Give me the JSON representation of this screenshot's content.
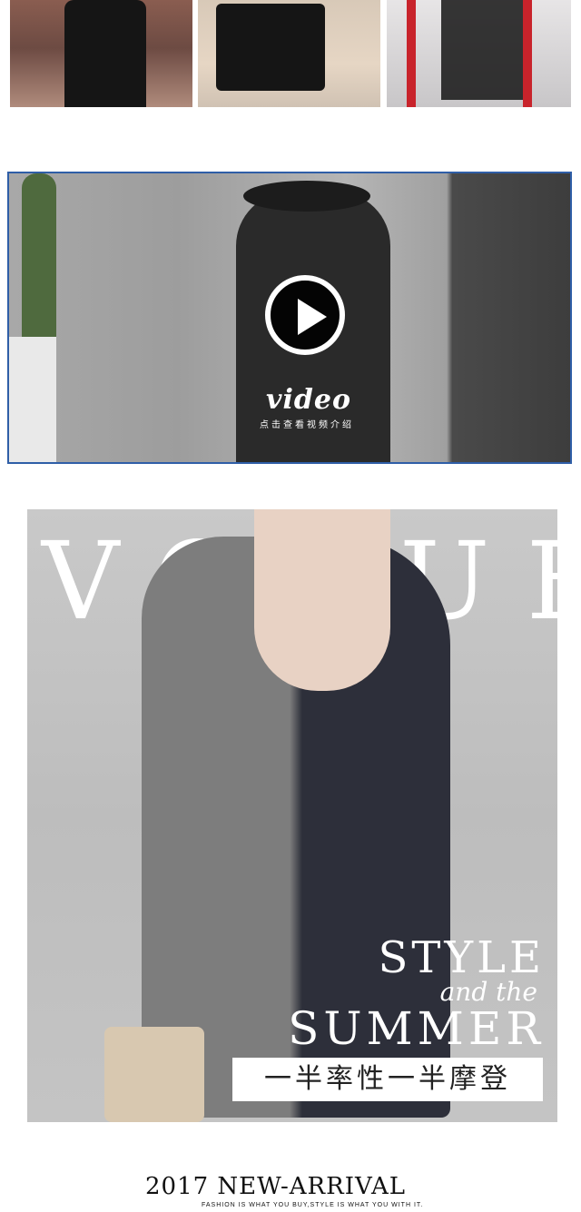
{
  "thumbnails": [
    {
      "label": "thumb-1"
    },
    {
      "label": "thumb-2"
    },
    {
      "label": "thumb-3"
    }
  ],
  "video": {
    "title": "video",
    "subtitle": "点击查看视频介绍"
  },
  "hero": {
    "bg_word": "VOGUE",
    "line1": "STYLE",
    "line2": "and the",
    "line3": "SUMMER",
    "banner": "一半率性一半摩登"
  },
  "footer": {
    "title": "2017 NEW-ARRIVAL",
    "subtitle": "FASHION IS WHAT YOU BUY,STYLE IS WHAT YOU WITH IT."
  }
}
